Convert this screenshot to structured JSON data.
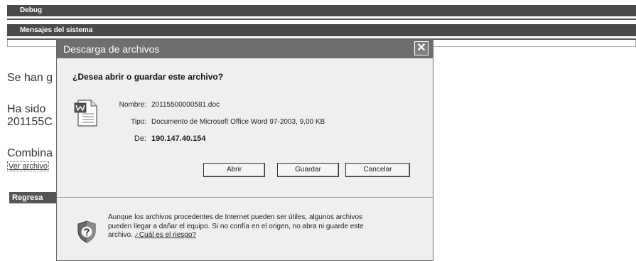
{
  "page": {
    "debug_label": "Debug",
    "messages_label": "Mensajes del sistema",
    "text_sehan": "Se han g",
    "text_hasido_line1": "Ha sido",
    "text_hasido_line2": "201155C",
    "text_combina": "Combina",
    "view_file_link": "Ver archivo",
    "back_button": "Regresa"
  },
  "dialog": {
    "title": "Descarga de archivos",
    "close_symbol": "✕",
    "question": "¿Desea abrir o guardar este archivo?",
    "name_label": "Nombre:",
    "name_value": "20115500000581.doc",
    "type_label": "Tipo:",
    "type_value": "Documento de Microsoft Office Word 97-2003, 9,00 KB",
    "from_label": "De:",
    "from_value": "190.147.40.154",
    "buttons": {
      "open": "Abrir",
      "save": "Guardar",
      "cancel": "Cancelar"
    },
    "warning_text": "Aunque los archivos procedentes de Internet pueden ser útiles, algunos archivos pueden llegar a dañar el equipo. Si no confía en el origen, no abra ni guarde este archivo. ",
    "risk_link": "¿Cuál es el riesgo?",
    "icons": {
      "file": "word-document-icon",
      "warning": "security-shield-icon"
    }
  }
}
